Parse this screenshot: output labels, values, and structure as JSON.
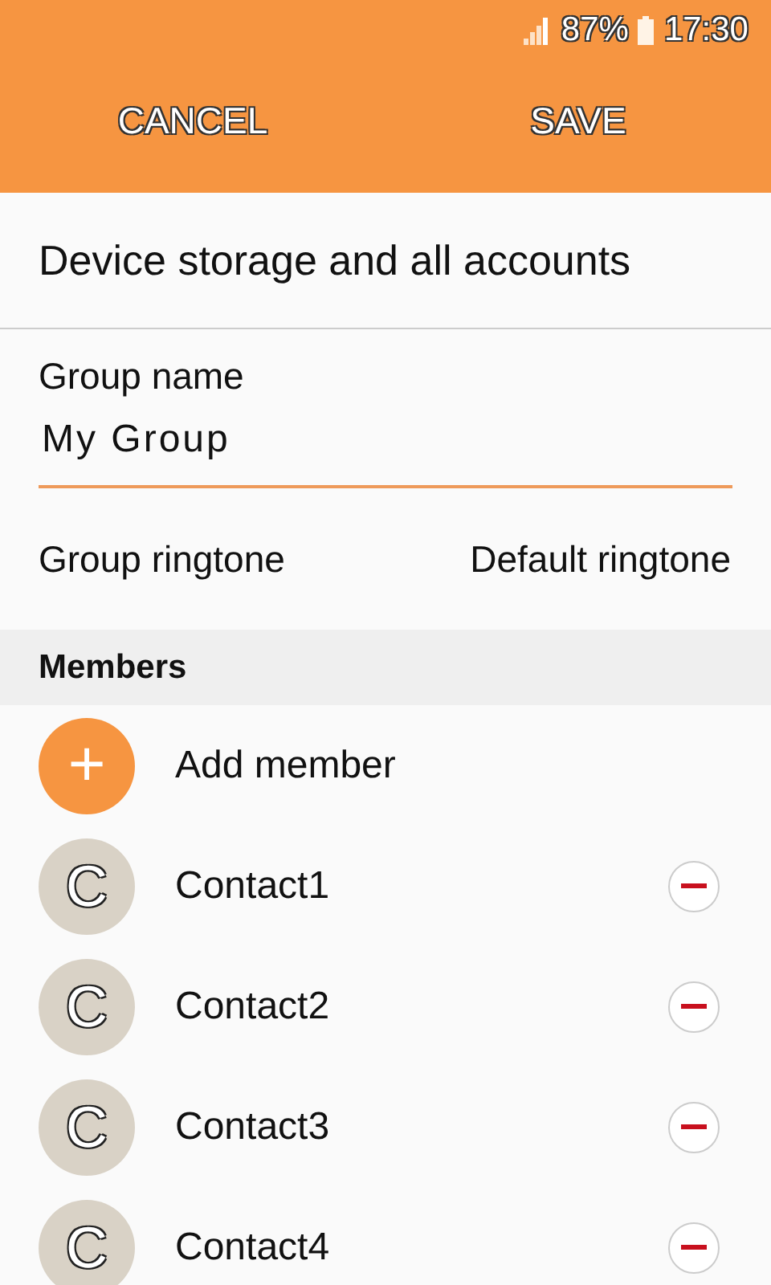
{
  "status_bar": {
    "battery": "87%",
    "time": "17:30"
  },
  "action_bar": {
    "cancel": "CANCEL",
    "save": "SAVE"
  },
  "storage": "Device storage and all accounts",
  "group_name": {
    "label": "Group name",
    "value": "My Group"
  },
  "ringtone": {
    "label": "Group ringtone",
    "value": "Default ringtone"
  },
  "members_header": "Members",
  "add_member": {
    "icon": "+",
    "label": "Add member"
  },
  "members": [
    {
      "initial": "C",
      "name": "Contact1"
    },
    {
      "initial": "C",
      "name": "Contact2"
    },
    {
      "initial": "C",
      "name": "Contact3"
    },
    {
      "initial": "C",
      "name": "Contact4"
    }
  ]
}
